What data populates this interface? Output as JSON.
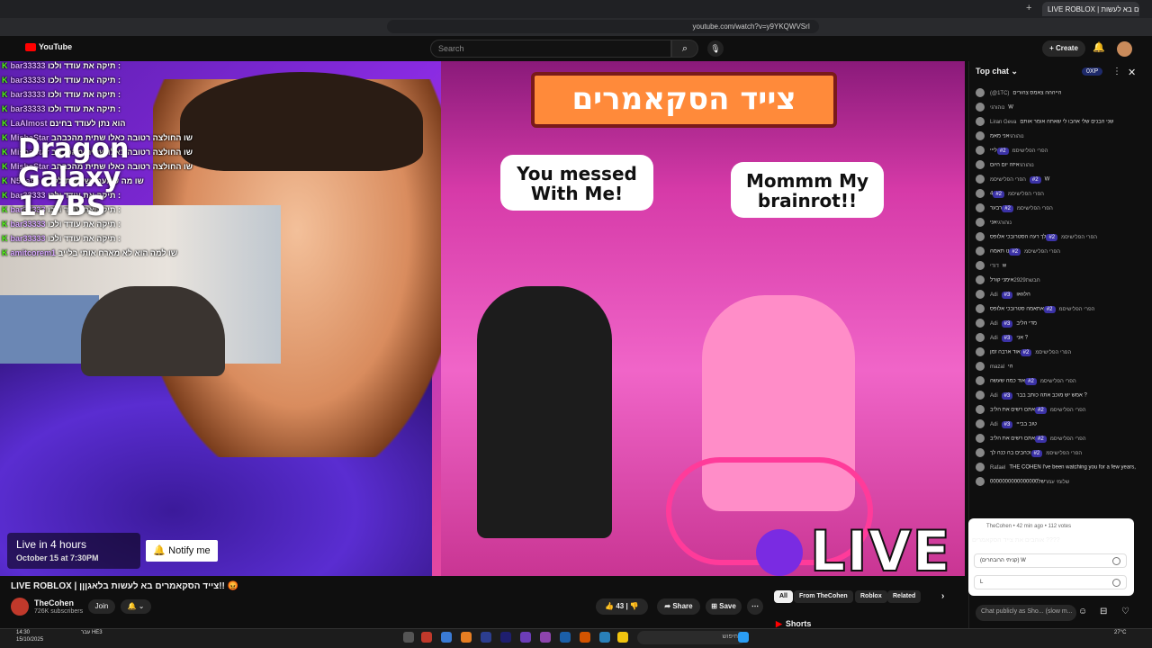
{
  "browser": {
    "tab_title": "LIVE ROBLOX | צייד הסקאמרים בא לעשות...",
    "url": "youtube.com/watch?v=y9YKQWVSrI"
  },
  "header": {
    "logo": "YouTube",
    "search_placeholder": "Search",
    "create_label": "Create"
  },
  "overlay": {
    "lines": [
      {
        "name": "bar33333",
        "text": "תיקה את עודד ולכו :"
      },
      {
        "name": "bar33333",
        "text": "תיקה את עודד ולכו :"
      },
      {
        "name": "bar33333",
        "text": "תיקה את עודד ולכו :"
      },
      {
        "name": "bar33333",
        "text": "תיקה את עודד ולכו :"
      },
      {
        "name": "LaAlmost",
        "text": "הוא נתן לעודד בחינם"
      },
      {
        "name": "MishaStar",
        "text": "שו החולצה רטובה כאלו שתית מהכבהב"
      },
      {
        "name": "MishaStar",
        "text": "שו החולצה רטובה כאלו שתית מהכבהב"
      },
      {
        "name": "MishaStar",
        "text": "שו החולצה רטובה כאלו שתית מהכבהב"
      },
      {
        "name": "N5dash",
        "text": "שו מה שמעתי שעשית לקבת"
      },
      {
        "name": "bar33333",
        "text": "תיקה את עודד ולכו :"
      },
      {
        "name": "bar33333",
        "text": "תיקה את עודד ולכו :"
      },
      {
        "name": "bar33333",
        "text": "תיקה את עודד ולכו :"
      },
      {
        "name": "bar33333",
        "text": "תיקה את עודד ולכו :"
      },
      {
        "name": "amitcorem1",
        "text": "שו למה הוא לא מארח אותי בלייב"
      }
    ],
    "dragon_text": "Dragon Galaxy 1.7BS"
  },
  "video": {
    "sign_text": "צייד הסקאמרים",
    "bubble_left": "You messed With Me!",
    "bubble_right": "Mommm My brainrot!!",
    "live_badge": "LIVE",
    "live_in": "Live in 4 hours",
    "live_date": "October 15 at 7:30PM",
    "notify_label": "Notify me"
  },
  "meta": {
    "title": "LIVE ROBLOX | צייד הסקאמרים בא לעשות בלאגןןן!! 😡",
    "channel": "TheCohen",
    "subscribers": "726K subscribers",
    "join": "Join",
    "likes": "43",
    "share": "Share",
    "save": "Save"
  },
  "chips": [
    "All",
    "From TheCohen",
    "Roblox",
    "Related"
  ],
  "shorts_label": "Shorts",
  "chat": {
    "header": "Top chat",
    "xp": "0XP",
    "messages": [
      {
        "author": "(@1TC)",
        "badge": "",
        "text": "הייההה צאמס צהורים"
      },
      {
        "author": "נוהורגי",
        "badge": "",
        "text": "W"
      },
      {
        "author": "Liran Geva",
        "badge": "",
        "text": "שני הבנים שלי אהבו לי שאתה אומר אותם"
      },
      {
        "author": "נוהורגי",
        "badge": "",
        "text": "אני מאמ"
      },
      {
        "author": "הפרי הפלישיסמ",
        "badge": "#2",
        "text": "לייי"
      },
      {
        "author": "נוהורגי",
        "badge": "",
        "text": "איזה יום היום"
      },
      {
        "author": "הפרי הפלישיסמ",
        "badge": "#2",
        "text": "W"
      },
      {
        "author": "הפרי הפלישיסמ",
        "badge": "#2",
        "text": "4"
      },
      {
        "author": "הפרי הפלישיסמ",
        "badge": "#2",
        "text": "רבער"
      },
      {
        "author": "נוהורגי",
        "badge": "",
        "text": "אני"
      },
      {
        "author": "הפרי הפלישיסמ",
        "badge": "#2",
        "text": "לך רעה הסטרובכי אלופס"
      },
      {
        "author": "הפרי הפלישיסמ",
        "badge": "#2",
        "text": "נו תאמה"
      },
      {
        "author": "דודי",
        "badge": "",
        "text": "w"
      },
      {
        "author": "חבשת2929",
        "badge": "",
        "text": "אימני קורל"
      },
      {
        "author": "Adi",
        "badge": "#3",
        "text": "הלוואו"
      },
      {
        "author": "הפרי הפלישיסמ",
        "badge": "#2",
        "text": "אתאמה סטרובכי אלופס"
      },
      {
        "author": "Adi",
        "badge": "#3",
        "text": "מדי הליב"
      },
      {
        "author": "Adi",
        "badge": "#3",
        "text": "אני ?"
      },
      {
        "author": "הפרי הפלישיסמ",
        "badge": "#2",
        "text": "אוד ארבה זמן"
      },
      {
        "author": "mazal",
        "badge": "",
        "text": "הי"
      },
      {
        "author": "הפרי הפלישיסמ",
        "badge": "#2",
        "text": "אוד כמה שעשה"
      },
      {
        "author": "Adi",
        "badge": "#3",
        "text": "אמש יש מוכב אתה כותב בבר ?"
      },
      {
        "author": "הפרי הפלישיסמ",
        "badge": "#2",
        "text": "אתם רשים את הליב"
      },
      {
        "author": "Adi",
        "badge": "#3",
        "text": "טוב בבייי"
      },
      {
        "author": "הפרי הפלישיסמ",
        "badge": "#2",
        "text": "אתם רשים את הליב"
      },
      {
        "author": "הפרי הפלישיסמ",
        "badge": "#2",
        "text": "וכהבים בה כנה לך"
      },
      {
        "author": "Rafael",
        "badge": "",
        "text": "THE COHEN I've been watching you for a few years, I'm a big fan of yours"
      },
      {
        "author": "שלומי עמר",
        "badge": "",
        "text": "של0000000000000000"
      }
    ],
    "poll": {
      "meta": "TheCohen • 42 min ago • 112 votes",
      "question": "אוהבים את צייד הסקאמרים ????",
      "options": [
        "(קניתי הרובחרים) W",
        "L"
      ]
    },
    "input_placeholder": "Chat publicly as Sho... (slow m..."
  },
  "taskbar": {
    "time": "14:30",
    "date": "15/10/2025",
    "lang": "עבר HE3",
    "search": "חיפוש",
    "weather": "27°C"
  }
}
